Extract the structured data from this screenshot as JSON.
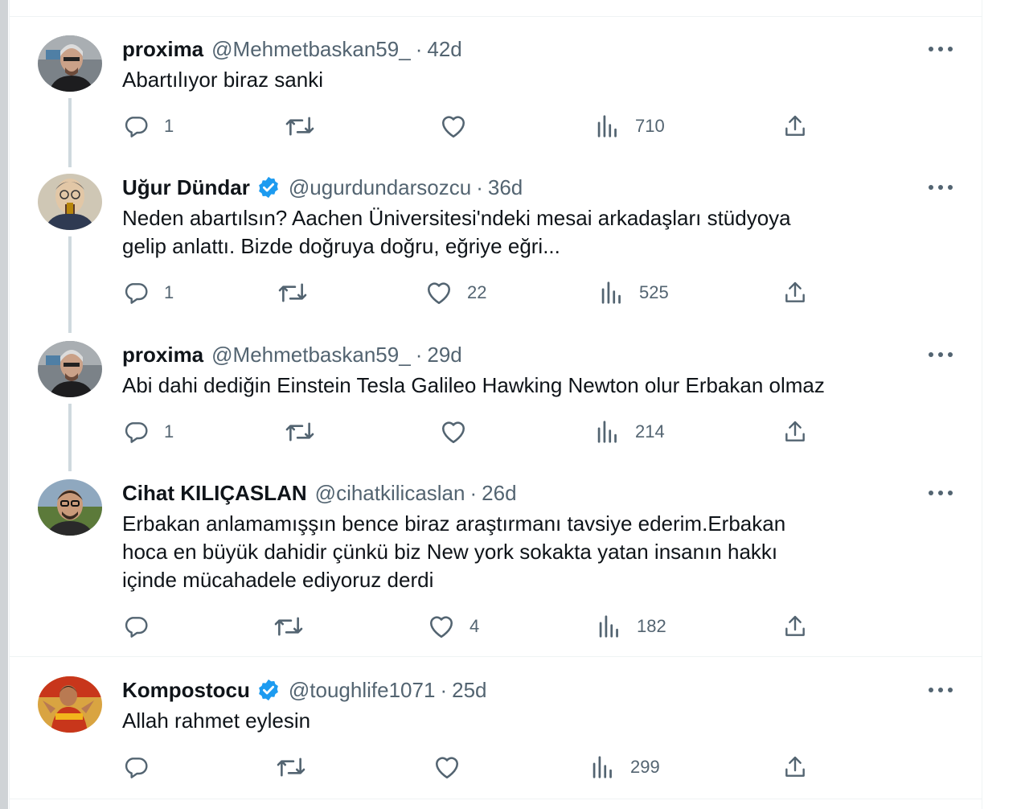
{
  "tweets": [
    {
      "name": "proxima",
      "handle": "@Mehmetbaskan59_",
      "time": "42d",
      "verified": false,
      "lines": [
        "Abartılıyor biraz sanki"
      ],
      "replies": "1",
      "retweets": "",
      "likes": "",
      "views": "710",
      "avatar": "avatar-man-glasses"
    },
    {
      "name": "Uğur Dündar",
      "handle": "@ugurdundarsozcu",
      "time": "36d",
      "verified": true,
      "lines": [
        "Neden abartılsın? Aachen Üniversitesi'ndeki mesai arkadaşları stüdyoya",
        "gelip  anlattı. Bizde doğruya doğru, eğriye eğri..."
      ],
      "replies": "1",
      "retweets": "",
      "likes": "22",
      "views": "525",
      "avatar": "avatar-caricature"
    },
    {
      "name": "proxima",
      "handle": "@Mehmetbaskan59_",
      "time": "29d",
      "verified": false,
      "lines": [
        "Abi dahi dediğin Einstein Tesla Galileo Hawking Newton olur Erbakan olmaz"
      ],
      "replies": "1",
      "retweets": "",
      "likes": "",
      "views": "214",
      "avatar": "avatar-man-glasses"
    },
    {
      "name": "Cihat KILIÇASLAN",
      "handle": "@cihatkilicaslan",
      "time": "26d",
      "verified": false,
      "lines": [
        "Erbakan anlamamışşın bence biraz araştırmanı tavsiye ederim.Erbakan",
        "hoca en büyük dahidir çünkü biz New york sokakta yatan insanın hakkı",
        "içinde mücahadele ediyoruz derdi"
      ],
      "replies": "",
      "retweets": "",
      "likes": "4",
      "views": "182",
      "avatar": "avatar-man-outdoor"
    },
    {
      "name": "Kompostocu",
      "handle": "@toughlife1071",
      "time": "25d",
      "verified": true,
      "lines": [
        "Allah rahmet eylesin"
      ],
      "replies": "",
      "retweets": "",
      "likes": "",
      "views": "299",
      "avatar": "avatar-footballer"
    }
  ],
  "colors": {
    "text": "#0f1419",
    "secondary": "#536471",
    "verified": "#1d9bf0",
    "border": "#eff3f4",
    "thread_line": "#cfd9de"
  },
  "icons": {
    "reply": "reply-icon",
    "retweet": "retweet-icon",
    "like": "heart-icon",
    "views": "views-icon",
    "share": "share-icon",
    "more": "more-icon",
    "verified": "verified-badge-icon"
  },
  "separator": "·"
}
